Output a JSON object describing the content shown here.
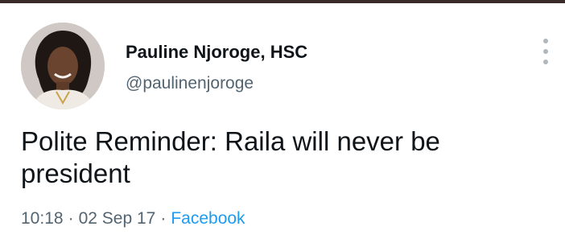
{
  "tweet": {
    "author": {
      "display_name": "Pauline Njoroge, HSC",
      "handle": "@paulinenjoroge"
    },
    "text": "Polite Reminder: Raila will never be president",
    "time": "10:18",
    "separator": "·",
    "date": "02 Sep 17",
    "source": "Facebook"
  },
  "icons": {
    "more": "more-vertical-icon",
    "avatar": "profile-photo"
  },
  "colors": {
    "name": "#0f1419",
    "secondary": "#536471",
    "link": "#1d9bf0",
    "top_bar": "#3a2a2a"
  }
}
